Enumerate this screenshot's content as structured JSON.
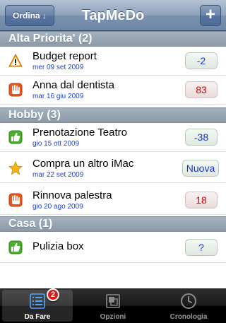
{
  "navbar": {
    "title": "TapMeDo",
    "sort_button": "Ordina ↓",
    "add_button": "+"
  },
  "sections": [
    {
      "header": "Alta Priorita' (2)",
      "items": [
        {
          "icon": "warning-icon",
          "title": "Budget report",
          "date": "mer 09 set 2009",
          "badge": "-2",
          "badge_color": "#1a36d8"
        },
        {
          "icon": "hand-stop-icon",
          "title": "Anna dal dentista",
          "date": "mar 16 giu 2009",
          "badge": "83",
          "badge_color": "#d40000"
        }
      ]
    },
    {
      "header": "Hobby (3)",
      "items": [
        {
          "icon": "thumbs-up-icon",
          "title": "Prenotazione Teatro",
          "date": "gio 15 ott 2009",
          "badge": "-38",
          "badge_color": "#1a36d8"
        },
        {
          "icon": "star-icon",
          "title": "Compra un altro iMac",
          "date": "mar 22 set 2009",
          "badge": "Nuova",
          "badge_color": "#1a36d8"
        },
        {
          "icon": "hand-stop-icon",
          "title": "Rinnova palestra",
          "date": "gio 20 ago 2009",
          "badge": "18",
          "badge_color": "#d40000"
        }
      ]
    },
    {
      "header": "Casa (1)",
      "items": [
        {
          "icon": "thumbs-up-icon",
          "title": "Pulizia box",
          "date": "",
          "badge": "?",
          "badge_color": "#1a36d8"
        }
      ]
    }
  ],
  "tabbar": {
    "tabs": [
      {
        "label": "Da Fare",
        "icon": "list-icon",
        "badge": "2",
        "active": true
      },
      {
        "label": "Opzioni",
        "icon": "options-icon",
        "active": false
      },
      {
        "label": "Cronologia",
        "icon": "clock-icon",
        "active": false
      }
    ]
  }
}
